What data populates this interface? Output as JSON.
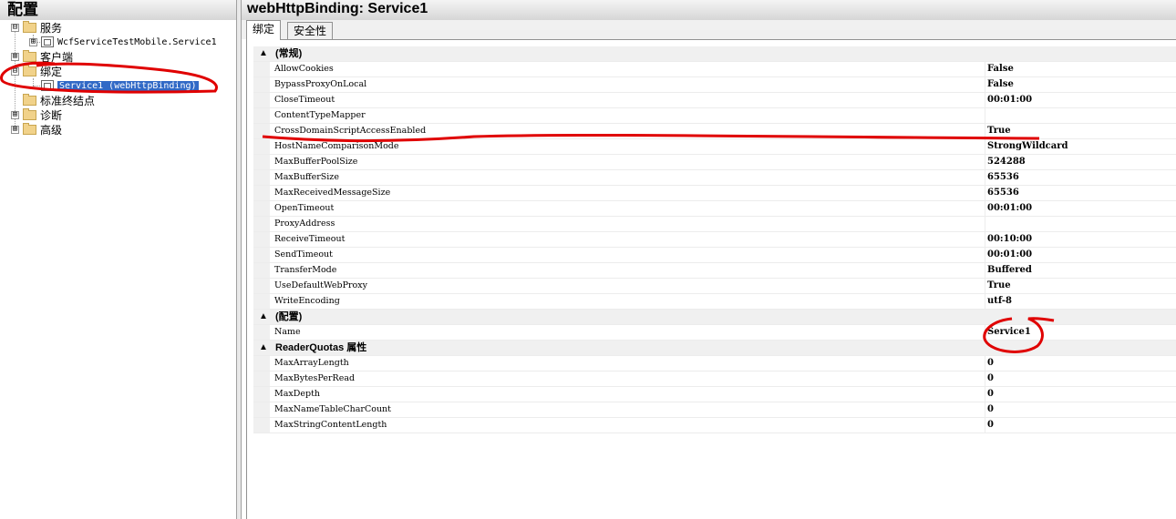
{
  "left_panel": {
    "title": "配置"
  },
  "tree": {
    "services": {
      "label": "服务",
      "expander": "⊟"
    },
    "service_item": {
      "label": "WcfServiceTestMobile.Service1",
      "expander": "⊞"
    },
    "client": {
      "label": "客户端",
      "expander": "⊞"
    },
    "bindings": {
      "label": "绑定",
      "expander": "⊟"
    },
    "binding_item": {
      "label": "Service1 (webHttpBinding)"
    },
    "standard_endpoints": {
      "label": "标准终结点"
    },
    "diagnostics": {
      "label": "诊断",
      "expander": "⊞"
    },
    "advanced": {
      "label": "高级",
      "expander": "⊞"
    }
  },
  "right_panel": {
    "title": "webHttpBinding: Service1"
  },
  "tabs": [
    {
      "label": "绑定"
    },
    {
      "label": "安全性"
    }
  ],
  "categories": {
    "general": {
      "label": "(常规)",
      "toggle": "▲"
    },
    "config": {
      "label": "(配置)",
      "toggle": "▲"
    },
    "reader_quotas": {
      "label": "ReaderQuotas 属性",
      "toggle": "▲"
    }
  },
  "general_props": [
    {
      "name": "AllowCookies",
      "value": "False"
    },
    {
      "name": "BypassProxyOnLocal",
      "value": "False"
    },
    {
      "name": "CloseTimeout",
      "value": "00:01:00"
    },
    {
      "name": "ContentTypeMapper",
      "value": ""
    },
    {
      "name": "CrossDomainScriptAccessEnabled",
      "value": "True"
    },
    {
      "name": "HostNameComparisonMode",
      "value": "StrongWildcard"
    },
    {
      "name": "MaxBufferPoolSize",
      "value": "524288"
    },
    {
      "name": "MaxBufferSize",
      "value": "65536"
    },
    {
      "name": "MaxReceivedMessageSize",
      "value": "65536"
    },
    {
      "name": "OpenTimeout",
      "value": "00:01:00"
    },
    {
      "name": "ProxyAddress",
      "value": ""
    },
    {
      "name": "ReceiveTimeout",
      "value": "00:10:00"
    },
    {
      "name": "SendTimeout",
      "value": "00:01:00"
    },
    {
      "name": "TransferMode",
      "value": "Buffered"
    },
    {
      "name": "UseDefaultWebProxy",
      "value": "True"
    },
    {
      "name": "WriteEncoding",
      "value": "utf-8"
    }
  ],
  "config_props": [
    {
      "name": "Name",
      "value": "Service1"
    }
  ],
  "reader_quota_props": [
    {
      "name": "MaxArrayLength",
      "value": "0"
    },
    {
      "name": "MaxBytesPerRead",
      "value": "0"
    },
    {
      "name": "MaxDepth",
      "value": "0"
    },
    {
      "name": "MaxNameTableCharCount",
      "value": "0"
    },
    {
      "name": "MaxStringContentLength",
      "value": "0"
    }
  ],
  "colors": {
    "selection": "#3169c6",
    "annotation": "#e00000",
    "folder": "#f1d28a"
  }
}
